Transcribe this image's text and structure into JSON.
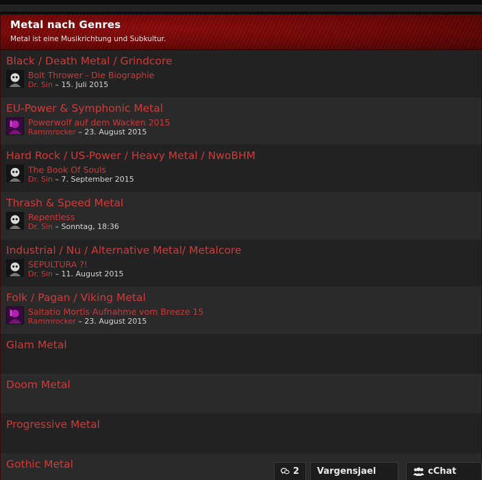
{
  "header": {
    "title": "Metal nach Genres",
    "subtitle": "Metal ist eine Musikrichtung und Subkultur."
  },
  "genres": [
    {
      "title": "Black / Death Metal / Grindcore",
      "thread": "Bolt Thrower - Die Biographie",
      "author": "Dr. Sin",
      "date": "– 15. Juli 2015"
    },
    {
      "title": "EU-Power & Symphonic Metal",
      "thread": "Powerwolf auf dem Wacken 2015",
      "author": "Rammrocker",
      "date": "– 23. August 2015"
    },
    {
      "title": "Hard Rock / US-Power / Heavy Metal / NwoBHM",
      "thread": "The Book Of Souls",
      "author": "Dr. Sin",
      "date": "– 7. September 2015"
    },
    {
      "title": "Thrash & Speed Metal",
      "thread": "Repentless",
      "author": "Dr. Sin",
      "date": "– Sonntag, 18:36"
    },
    {
      "title": "Industrial / Nu / Alternative Metal/ Metalcore",
      "thread": "SEPULTURA ?!",
      "author": "Dr. Sin",
      "date": "– 11. August 2015"
    },
    {
      "title": "Folk / Pagan / Viking Metal",
      "thread": "Saltatio Mortis Aufnahme vom Breeze 15",
      "author": "Rammrocker",
      "date": "– 23. August 2015"
    },
    {
      "title": "Glam Metal"
    },
    {
      "title": "Doom Metal"
    },
    {
      "title": "Progressive Metal"
    },
    {
      "title": "Gothic Metal"
    }
  ],
  "bottom_bar": {
    "conversation_count": "2",
    "username": "Vargensjael",
    "chat_label": "cChat"
  },
  "icons": {
    "conversation": "speech-bubbles-icon",
    "chat": "users-icon"
  },
  "colors": {
    "link": "#c83a3a",
    "header_red": "#7a0808"
  }
}
